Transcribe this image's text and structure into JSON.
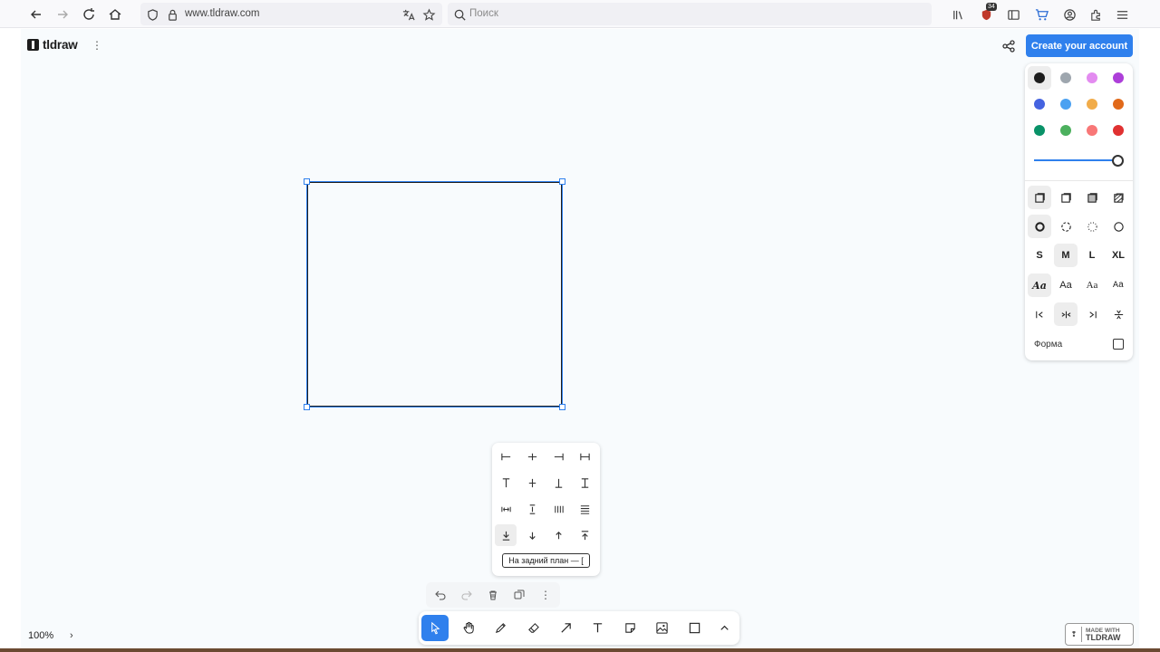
{
  "browser": {
    "url": "www.tldraw.com",
    "search_placeholder": "Поиск",
    "extension_badge": "34"
  },
  "app": {
    "logo_text": "tldraw",
    "create_account_label": "Create your account",
    "zoom_level": "100%"
  },
  "style_panel": {
    "colors": [
      "#1d1d1d",
      "#9ea6ae",
      "#e38bf0",
      "#ad3fd9",
      "#4563e0",
      "#4ba1f1",
      "#f1ac4a",
      "#e16919",
      "#099268",
      "#4cb05e",
      "#f87777",
      "#e03131"
    ],
    "selected_color": "#1d1d1d",
    "opacity": 1.0,
    "sizes": [
      "S",
      "M",
      "L",
      "XL"
    ],
    "selected_size": "M",
    "font_samples": [
      "Aa",
      "Aa",
      "Aa",
      "Aa"
    ],
    "shape_label": "Форма"
  },
  "align_menu": {
    "tooltip": "На задний план — ["
  },
  "branding": {
    "made_with_line1": "MADE WITH",
    "made_with_line2": "TLDRAW"
  }
}
